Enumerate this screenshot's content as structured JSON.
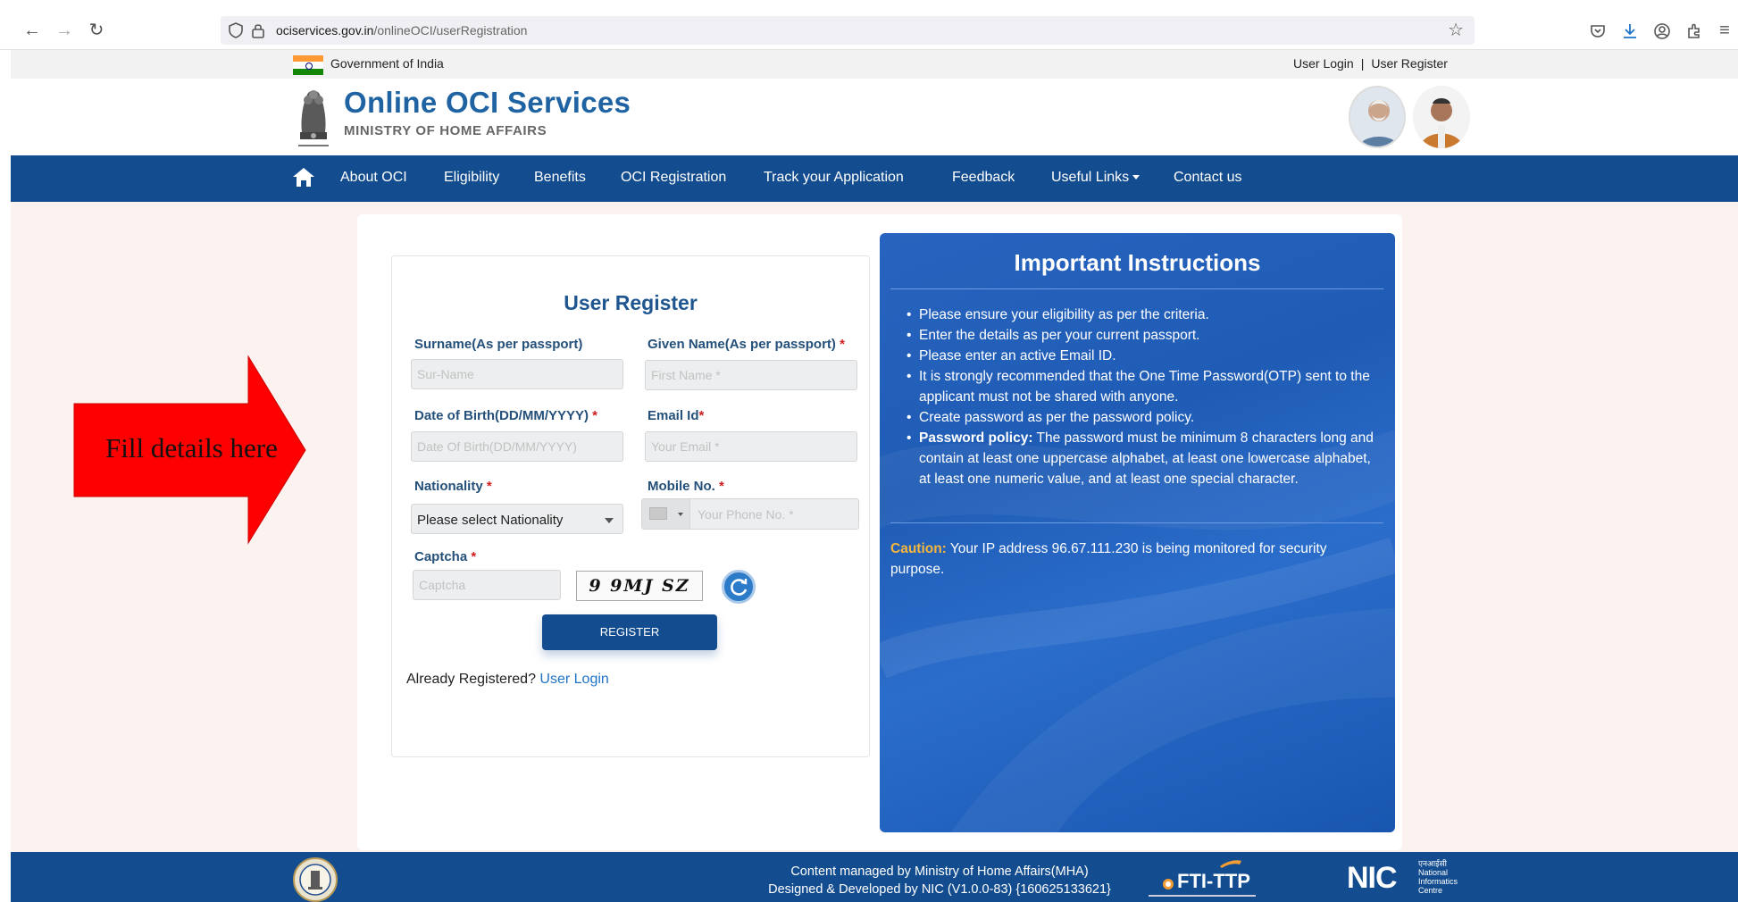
{
  "browser": {
    "url_domain": "ociservices.gov.in",
    "url_path": "/onlineOCI/userRegistration"
  },
  "gov_bar": {
    "text": "Government of India",
    "user_login": "User Login",
    "separator": "|",
    "user_register": "User Register"
  },
  "header": {
    "title": "Online OCI Services",
    "subtitle": "MINISTRY OF HOME AFFAIRS"
  },
  "nav": {
    "items": [
      "About OCI",
      "Eligibility",
      "Benefits",
      "OCI Registration",
      "Track your Application",
      "Feedback",
      "Useful Links",
      "Contact us"
    ]
  },
  "form": {
    "title": "User Register",
    "surname_label": "Surname(As per passport)",
    "surname_placeholder": "Sur-Name",
    "given_label": "Given Name(As per passport)",
    "given_placeholder": "First Name *",
    "dob_label": "Date of Birth(DD/MM/YYYY)",
    "dob_placeholder": "Date Of Birth(DD/MM/YYYY)",
    "email_label": "Email Id",
    "email_placeholder": "Your Email *",
    "nationality_label": "Nationality",
    "nationality_value": "Please select Nationality",
    "mobile_label": "Mobile No.",
    "mobile_placeholder": "Your Phone No. *",
    "captcha_label": "Captcha",
    "captcha_placeholder": "Captcha",
    "captcha_text": "9 9MJ SZ",
    "required_mark": "*",
    "register_button": "REGISTER",
    "already_text": "Already Registered?",
    "login_link": "User Login"
  },
  "instructions": {
    "title": "Important Instructions",
    "items": [
      "Please ensure your eligibility as per the criteria.",
      "Enter the details as per your current passport.",
      "Please enter an active Email ID.",
      "It is strongly recommended that the One Time Password(OTP) sent to the applicant must not be shared with anyone.",
      "Create password as per the password policy."
    ],
    "policy_label": "Password policy:",
    "policy_text": "The password must be minimum 8 characters long and contain at least one uppercase alphabet, at least one lowercase alphabet, at least one numeric value, and at least one special character.",
    "caution_label": "Caution:",
    "caution_text": "Your IP address 96.67.111.230 is being monitored for security purpose."
  },
  "footer": {
    "line1": "Content managed by Ministry of Home Affairs(MHA)",
    "line2": "Designed & Developed by NIC (V1.0.0-83) {160625133621}",
    "fti_logo": "FTI-TTP",
    "nic_logo": "NIC",
    "nic_hindi": "एनआईसी",
    "nic_sub": [
      "National",
      "Informatics",
      "Centre"
    ]
  },
  "annotation": {
    "label": "Fill details here",
    "arrow_color": "#ff0000"
  },
  "colors": {
    "brand_blue": "#134d8f",
    "title_blue": "#1f63a3",
    "required_red": "#d01c1c",
    "caution_orange": "#f5b63b"
  }
}
